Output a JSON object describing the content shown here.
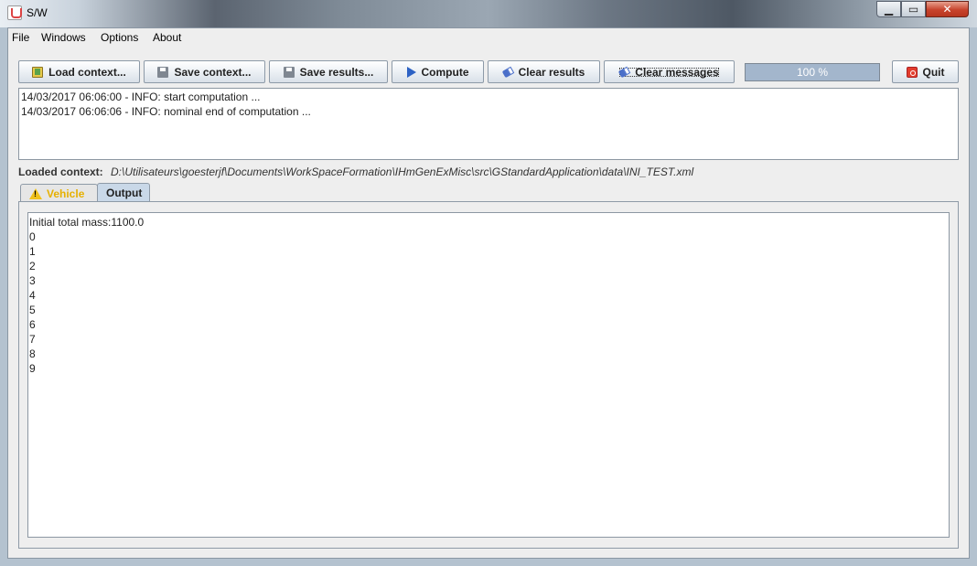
{
  "window": {
    "title": "S/W"
  },
  "menu": {
    "items": [
      "File",
      "Windows",
      "Options",
      "About"
    ]
  },
  "toolbar": {
    "load_label": "Load context...",
    "save_context_label": "Save context...",
    "save_results_label": "Save results...",
    "compute_label": "Compute",
    "clear_results_label": "Clear results",
    "clear_messages_label": "Clear messages",
    "quit_label": "Quit"
  },
  "progress": {
    "value_percent": 100,
    "text": "100 %"
  },
  "messages": {
    "lines": [
      "14/03/2017 06:06:00 - INFO: start computation ...",
      "14/03/2017 06:06:06 - INFO: nominal end of computation ..."
    ]
  },
  "context": {
    "label": "Loaded context:",
    "path": "D:\\Utilisateurs\\goesterjf\\Documents\\WorkSpaceFormation\\IHmGenExMisc\\src\\GStandardApplication\\data\\INI_TEST.xml"
  },
  "tabs": {
    "vehicle": "Vehicle",
    "output": "Output"
  },
  "output": {
    "lines": [
      "Initial total mass:1100.0",
      "0",
      "1",
      "2",
      "3",
      "4",
      "5",
      "6",
      "7",
      "8",
      "9"
    ]
  }
}
